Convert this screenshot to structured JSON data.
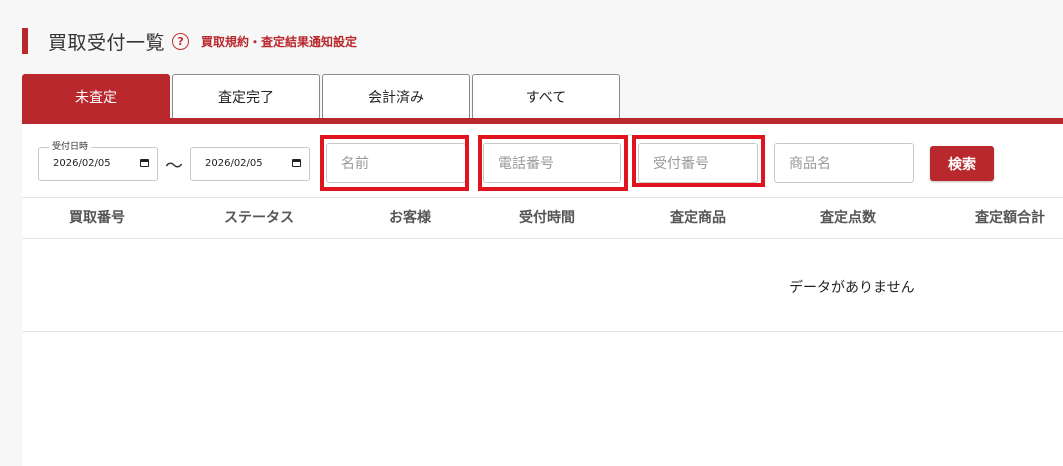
{
  "header": {
    "title": "買取受付一覧",
    "help_icon": "question-circle-icon",
    "link": "買取規約・査定結果通知設定"
  },
  "tabs": [
    {
      "label": "未査定",
      "active": true
    },
    {
      "label": "査定完了",
      "active": false
    },
    {
      "label": "会計済み",
      "active": false
    },
    {
      "label": "すべて",
      "active": false
    }
  ],
  "filters": {
    "date_legend": "受付日時",
    "date_from": "2026/02/05",
    "date_to": "2026/02/05",
    "separator": "〜",
    "name_placeholder": "名前",
    "phone_placeholder": "電話番号",
    "receipt_placeholder": "受付番号",
    "product_placeholder": "商品名",
    "search_label": "検索"
  },
  "table": {
    "columns": [
      "買取番号",
      "ステータス",
      "お客様",
      "受付時間",
      "査定商品",
      "査定点数",
      "査定額合計"
    ],
    "empty_message": "データがありません"
  },
  "colors": {
    "accent": "#b8282c",
    "highlight": "#e0141e"
  }
}
